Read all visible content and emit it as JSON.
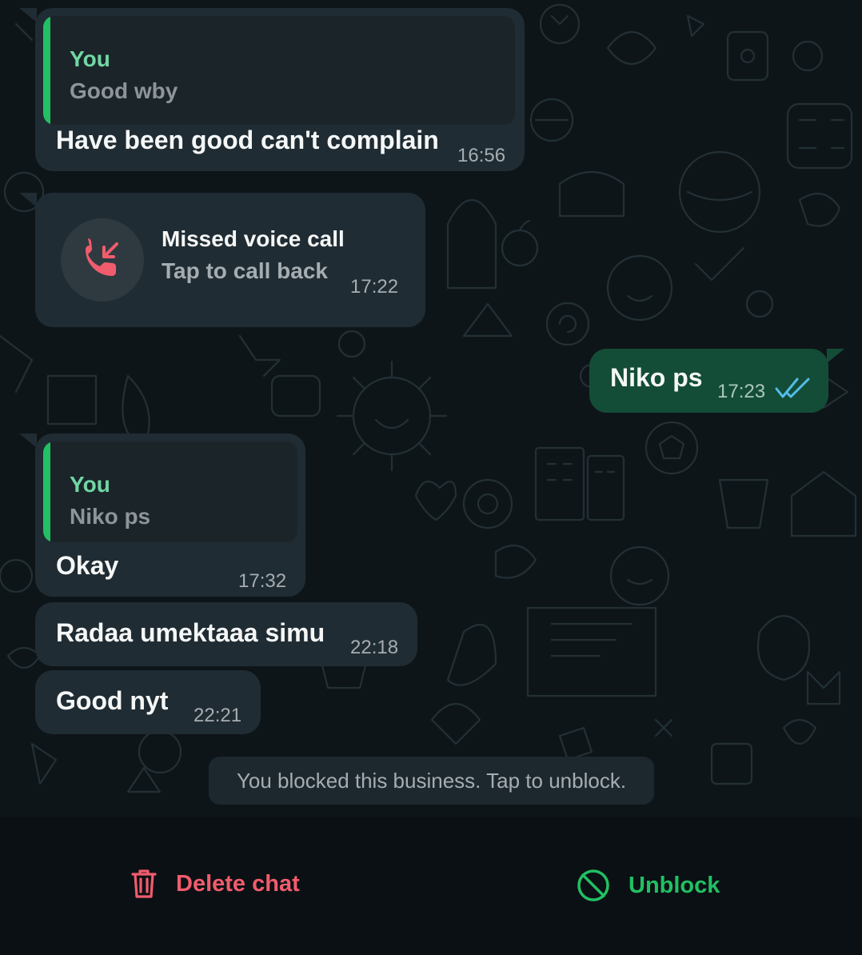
{
  "messages": [
    {
      "direction": "in",
      "quote": {
        "author": "You",
        "text": "Good wby"
      },
      "text": "Have been good can't complain",
      "time": "16:56"
    },
    {
      "direction": "in",
      "type": "missed_call",
      "title": "Missed voice call",
      "subtitle": "Tap to call back",
      "time": "17:22",
      "icon": "missed-call-icon"
    },
    {
      "direction": "out",
      "text": "Niko ps",
      "time": "17:23",
      "status": "read",
      "status_icon": "double-check-icon"
    },
    {
      "direction": "in",
      "quote": {
        "author": "You",
        "text": "Niko ps"
      },
      "text": "Okay",
      "time": "17:32"
    },
    {
      "direction": "in",
      "text": "Radaa umektaaa simu",
      "time": "22:18"
    },
    {
      "direction": "in",
      "text": "Good nyt",
      "time": "22:21"
    }
  ],
  "notice": "You blocked this business. Tap to unblock.",
  "actions": {
    "delete": {
      "label": "Delete chat",
      "icon": "trash-icon",
      "color": "#f15c6d"
    },
    "unblock": {
      "label": "Unblock",
      "icon": "block-icon",
      "color": "#21c063"
    }
  },
  "colors": {
    "incoming_bubble": "#202c33",
    "outgoing_bubble": "#144d37",
    "accent_green": "#21c063",
    "read_tick": "#53bdeb"
  }
}
